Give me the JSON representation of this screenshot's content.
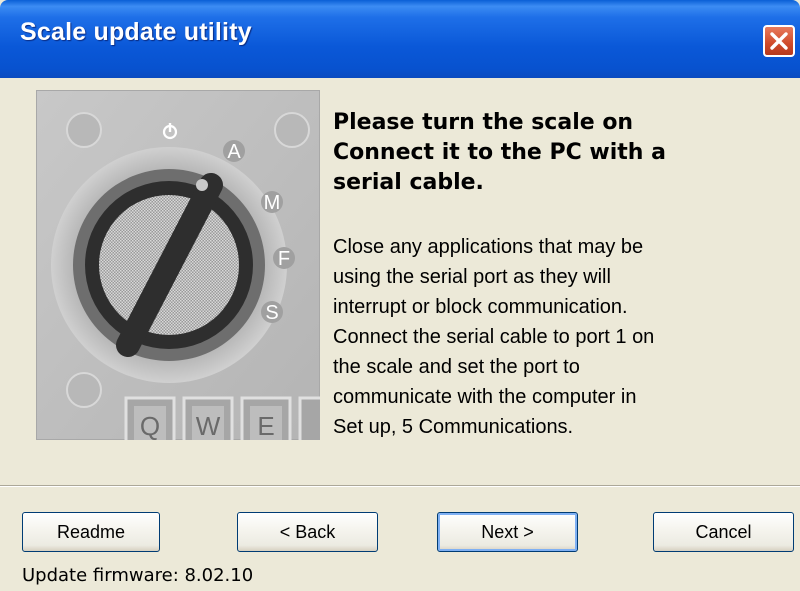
{
  "window": {
    "title": "Scale update utility"
  },
  "content": {
    "heading_lines": [
      "Please turn the scale on",
      "Connect it to the PC with a",
      "serial cable."
    ],
    "instruction_lines": [
      "Close any applications that may be",
      "using the serial port as they will",
      "interrupt or block communication.",
      "Connect the serial cable to port 1 on",
      "the scale and set the port to",
      "communicate with the computer in",
      "Set up, 5 Communications."
    ]
  },
  "illustration": {
    "dial_labels": [
      "A",
      "M",
      "F",
      "S"
    ],
    "keys": [
      "Q",
      "W",
      "E"
    ]
  },
  "buttons": {
    "readme": "Readme",
    "back": "< Back",
    "next": "Next >",
    "cancel": "Cancel"
  },
  "status": {
    "text": "Update firmware: 8.02.10"
  },
  "icons": {
    "close": "close-icon",
    "power": "power-icon"
  },
  "colors": {
    "titlebar": "#0a58d8",
    "window_bg": "#ece9d8",
    "close_button": "#cf4a2a"
  }
}
